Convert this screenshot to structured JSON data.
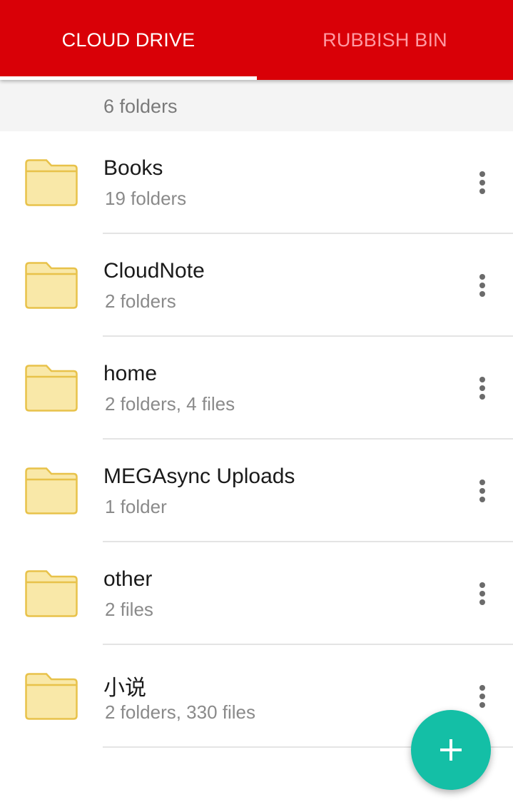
{
  "tabs": {
    "cloud_drive": "CLOUD DRIVE",
    "rubbish_bin": "RUBBISH BIN"
  },
  "summary": "6 folders",
  "colors": {
    "toolbar": "#d90007",
    "tab_inactive": "#ff9aa3",
    "fab": "#14bfa6",
    "folder_fill": "#f9e8a8",
    "folder_stroke": "#e8c24a"
  },
  "items": [
    {
      "name": "Books",
      "meta": "19 folders",
      "icon": "folder-icon"
    },
    {
      "name": "CloudNote",
      "meta": "2 folders",
      "icon": "folder-icon"
    },
    {
      "name": "home",
      "meta": "2 folders, 4 files",
      "icon": "folder-icon"
    },
    {
      "name": "MEGAsync Uploads",
      "meta": "1 folder",
      "icon": "folder-icon"
    },
    {
      "name": "other",
      "meta": "2 files",
      "icon": "folder-icon"
    },
    {
      "name": "小说",
      "meta": "2 folders, 330 files",
      "icon": "folder-icon"
    }
  ],
  "fab_icon": "plus-icon"
}
